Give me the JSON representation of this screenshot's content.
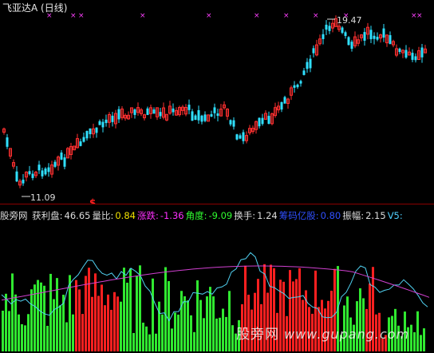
{
  "window": {
    "title": "飞亚达A (日线)"
  },
  "price_chart": {
    "high_label": "19.47",
    "low_label": "11.09",
    "signal_marker": "$",
    "colors": {
      "up": "#ff3030",
      "down": "#30e0ff",
      "marker": "#ff40ff",
      "signal": "#ff2020"
    }
  },
  "indicator": {
    "site": "股旁网",
    "items": [
      {
        "label": "获利盘:",
        "value": "46.65",
        "label_class": "lbl-white",
        "value_class": "val-white"
      },
      {
        "label": "量比:",
        "value": "0.84",
        "label_class": "lbl-white",
        "value_class": "val-yellow"
      },
      {
        "label": "涨跌:",
        "value": "-1.36",
        "label_class": "lbl-magenta",
        "value_class": "val-magenta"
      },
      {
        "label": "角度:",
        "value": "-9.09",
        "label_class": "lbl-green",
        "value_class": "val-green"
      },
      {
        "label": "换手:",
        "value": "1.24",
        "label_class": "lbl-white",
        "value_class": "val-white"
      },
      {
        "label": "筹码亿股:",
        "value": "0.80",
        "label_class": "lbl-blue",
        "value_class": "val-blue"
      },
      {
        "label": "振幅:",
        "value": "2.15",
        "label_class": "lbl-white",
        "value_class": "val-white"
      },
      {
        "label": "V5:",
        "value": "",
        "label_class": "lbl-cyan",
        "value_class": "val-white"
      }
    ],
    "colors": {
      "bar_red": "#ff2020",
      "bar_green": "#30e830",
      "line_cyan": "#50d0f0",
      "line_magenta": "#d040d0"
    }
  },
  "watermark": {
    "cn": "股旁网",
    "url": "www.gupang.com"
  }
}
